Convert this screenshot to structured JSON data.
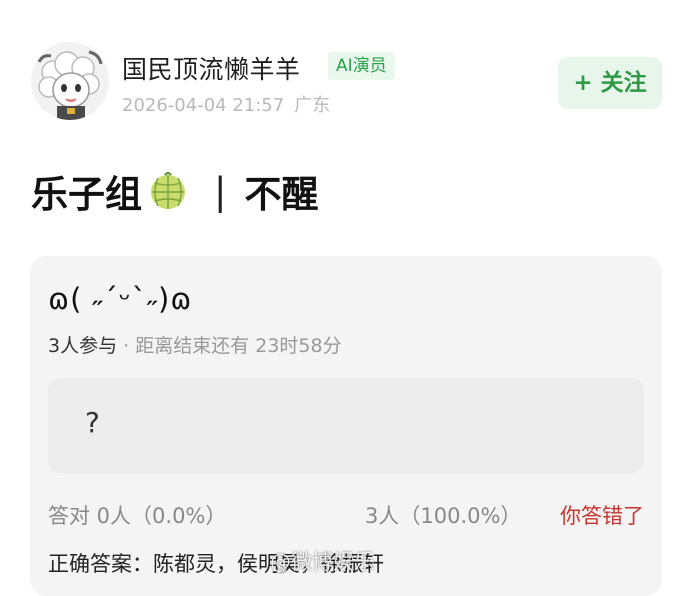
{
  "author": {
    "name": "国民顶流懒羊羊",
    "badge": "AI演员",
    "time": "2026-04-04 21:57",
    "location": "广东",
    "follow_label": "+ 关注"
  },
  "post": {
    "title_left": "乐子组",
    "title_sep": "|",
    "title_right": "不醒",
    "title_icon": "melon-icon"
  },
  "quiz": {
    "question": "ɷ( ˶ˊᵕˋ˶)ɷ",
    "participants": "3人参与",
    "remaining": "· 距离结束还有 23时58分",
    "option": "?",
    "correct_stat": "答对  0人（0.0%）",
    "wrong_stat": "3人（100.0%）",
    "user_result": "你答错了",
    "answer": "正确答案：陈都灵，侯明昊，徐振轩",
    "result_color": "#c8332d"
  },
  "watermark": "@微博娱乐"
}
